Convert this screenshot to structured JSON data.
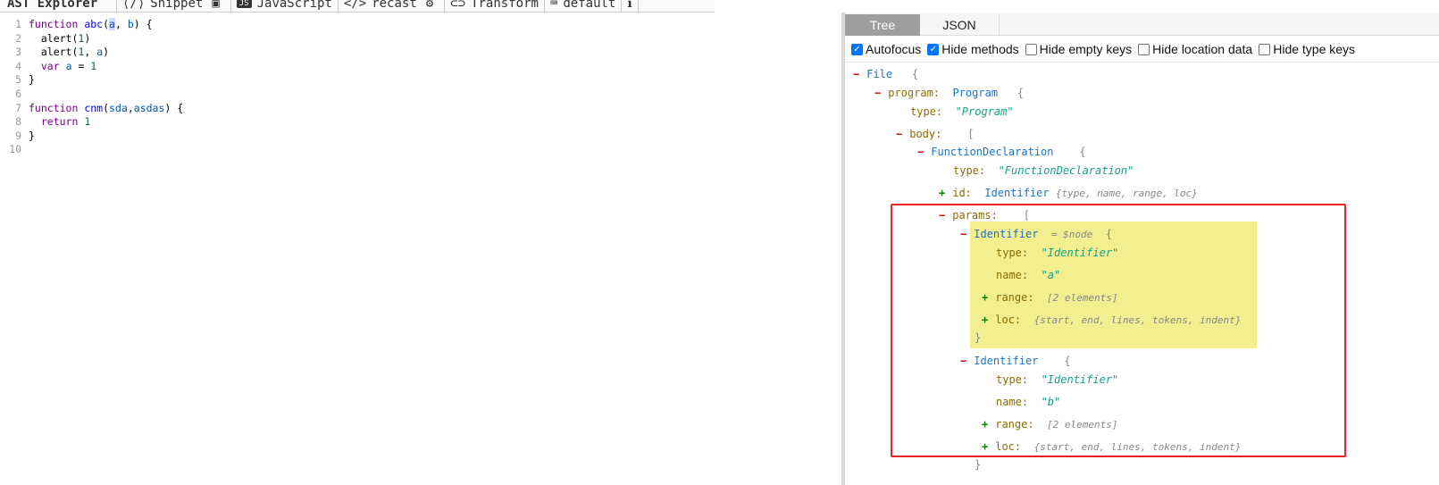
{
  "toolbar": {
    "title": "AST Explorer",
    "snippet": "Snippet",
    "language": "JavaScript",
    "parser": "recast",
    "transform": "Transform",
    "default": "default"
  },
  "editor": {
    "lines": [
      {
        "n": "1",
        "html": "<span class=\"kw\">function</span> <span class=\"fn\">abc</span>(<span class=\"hl var\">a</span>, <span class=\"var\">b</span>) {"
      },
      {
        "n": "2",
        "html": "  alert(<span class=\"num\">1</span>)"
      },
      {
        "n": "3",
        "html": "  alert(<span class=\"num\">1</span>, <span class=\"var\">a</span>)"
      },
      {
        "n": "4",
        "html": "  <span class=\"kw\">var</span> <span class=\"var\">a</span> = <span class=\"num\">1</span>"
      },
      {
        "n": "5",
        "html": "}"
      },
      {
        "n": "6",
        "html": ""
      },
      {
        "n": "7",
        "html": "<span class=\"kw\">function</span> <span class=\"fn\">cnm</span>(<span class=\"var\">sda</span>,<span class=\"var\">asdas</span>) {"
      },
      {
        "n": "8",
        "html": "  <span class=\"kw\">return</span> <span class=\"num\">1</span>"
      },
      {
        "n": "9",
        "html": "}"
      },
      {
        "n": "10",
        "html": ""
      }
    ]
  },
  "panel": {
    "tabs": [
      "Tree",
      "JSON"
    ],
    "options": [
      {
        "label": "Autofocus",
        "checked": true
      },
      {
        "label": "Hide methods",
        "checked": true
      },
      {
        "label": "Hide empty keys",
        "checked": false
      },
      {
        "label": "Hide location data",
        "checked": false
      },
      {
        "label": "Hide type keys",
        "checked": false
      }
    ]
  },
  "tree": {
    "file_label": "File",
    "program_key": "program:",
    "program_type": "Program",
    "program_type_key": "type:",
    "program_type_val": "\"Program\"",
    "body_key": "body:",
    "fd_type": "FunctionDeclaration",
    "fd_type_key": "type:",
    "fd_type_val": "\"FunctionDeclaration\"",
    "id_key": "id:",
    "id_type": "Identifier",
    "id_meta": "{type, name, range, loc}",
    "params_key": "params:",
    "p1_type": "Identifier",
    "p1_node": "= $node",
    "p1_type_key": "type:",
    "p1_type_val": "\"Identifier\"",
    "p1_name_key": "name:",
    "p1_name_val": "\"a\"",
    "p1_range_key": "range:",
    "p1_range_meta": "[2 elements]",
    "p1_loc_key": "loc:",
    "p1_loc_meta": "{start, end, lines, tokens, indent}",
    "p2_type": "Identifier",
    "p2_type_key": "type:",
    "p2_type_val": "\"Identifier\"",
    "p2_name_key": "name:",
    "p2_name_val": "\"b\"",
    "p2_range_key": "range:",
    "p2_range_meta": "[2 elements]",
    "p2_loc_key": "loc:",
    "p2_loc_meta": "{start, end, lines, tokens, indent}"
  }
}
